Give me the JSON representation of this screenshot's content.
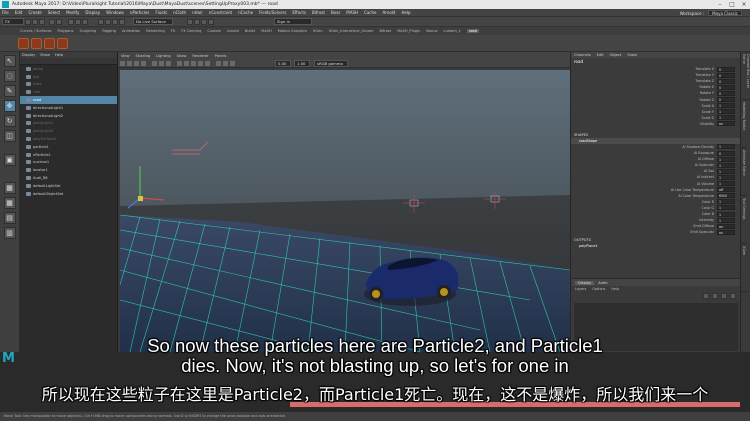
{
  "window": {
    "title": "Autodesk Maya 2017: D:\\Video\\Pluralsight Tutorial\\2016\\Maya\\Dust\\MayaDust\\scenes\\SettingUpProxy003.mb* --- road"
  },
  "menubar": {
    "items": [
      "File",
      "Edit",
      "Create",
      "Select",
      "Modify",
      "Display",
      "Windows",
      "nParticles",
      "Fluids",
      "nCloth",
      "nHair",
      "nConstraint",
      "nCache",
      "Fields/Solvers",
      "Effects",
      "Bifrost",
      "Boss",
      "MASH",
      "Cache",
      "Arnold",
      "Help"
    ],
    "workspace_label": "Workspace :",
    "workspace_value": "Maya Classic"
  },
  "statusline": {
    "mode": "FX",
    "live_surface": "No Live Surface",
    "sign_in": "Sign In"
  },
  "shelf": {
    "tabs": [
      "Curves / Surfaces",
      "Polygons",
      "Sculpting",
      "Rigging",
      "Animation",
      "Rendering",
      "FX",
      "FX Caching",
      "Custom",
      "Arnold",
      "Bullet",
      "MASH",
      "Motion Graphics",
      "XGen",
      "XGen_Interactive_Groom",
      "Bifrost",
      "MASH_Plugin",
      "Bonus",
      "custom_1",
      "road"
    ],
    "active_tab": "road"
  },
  "outliner": {
    "menu": [
      "Display",
      "Show",
      "Help"
    ],
    "items": [
      {
        "label": "persp",
        "dim": true
      },
      {
        "label": "top",
        "dim": true
      },
      {
        "label": "front",
        "dim": true
      },
      {
        "label": "side",
        "dim": true
      },
      {
        "label": "road",
        "dim": false,
        "selected": true
      },
      {
        "label": "directionalLight1",
        "dim": false
      },
      {
        "label": "directionalLight2",
        "dim": false
      },
      {
        "label": "pointLight1",
        "dim": true
      },
      {
        "label": "pointLight2",
        "dim": true
      },
      {
        "label": "polySurface1",
        "dim": true
      },
      {
        "label": "particle1",
        "dim": false
      },
      {
        "label": "nParticle1",
        "dim": false
      },
      {
        "label": "nucleus1",
        "dim": false
      },
      {
        "label": "locator1",
        "dim": false
      },
      {
        "label": "Audi_R8",
        "dim": false
      },
      {
        "label": "defaultLightSet",
        "dim": false
      },
      {
        "label": "defaultObjectSet",
        "dim": false
      }
    ]
  },
  "viewport": {
    "menu": [
      "View",
      "Shading",
      "Lighting",
      "Show",
      "Renderer",
      "Panels"
    ],
    "near_value": "0.00",
    "far_value": "1.00",
    "color_space": "sRGB gamma"
  },
  "channelbox": {
    "menu": [
      "Channels",
      "Edit",
      "Object",
      "Show"
    ],
    "object": "road",
    "channels": [
      {
        "label": "Translate X",
        "value": "0"
      },
      {
        "label": "Translate Y",
        "value": "0"
      },
      {
        "label": "Translate Z",
        "value": "0"
      },
      {
        "label": "Rotate X",
        "value": "0"
      },
      {
        "label": "Rotate Y",
        "value": "0"
      },
      {
        "label": "Rotate Z",
        "value": "0"
      },
      {
        "label": "Scale X",
        "value": "1"
      },
      {
        "label": "Scale Y",
        "value": "1"
      },
      {
        "label": "Scale Z",
        "value": "1"
      },
      {
        "label": "Visibility",
        "value": "on"
      }
    ],
    "shapes_label": "SHAPES",
    "shape_name": "roadShape",
    "shape_channels": [
      {
        "label": "Ai Shadow Density",
        "value": "1"
      },
      {
        "label": "Ai Exposure",
        "value": "0"
      },
      {
        "label": "Ai Diffuse",
        "value": "1"
      },
      {
        "label": "Ai Specular",
        "value": "1"
      },
      {
        "label": "Ai Sss",
        "value": "1"
      },
      {
        "label": "Ai Indirect",
        "value": "1"
      },
      {
        "label": "Ai Volume",
        "value": "1"
      },
      {
        "label": "Ai Use Color Temperature",
        "value": "off"
      },
      {
        "label": "Ai Color Temperature",
        "value": "6500"
      },
      {
        "label": "Color R",
        "value": "1"
      },
      {
        "label": "Color G",
        "value": "1"
      },
      {
        "label": "Color B",
        "value": "1"
      },
      {
        "label": "Intensity",
        "value": "1"
      },
      {
        "label": "Emit Diffuse",
        "value": "on"
      },
      {
        "label": "Emit Specular",
        "value": "on"
      }
    ],
    "outputs_label": "OUTPUTS",
    "output_name": "polyPlane1"
  },
  "layer_editor": {
    "tabs": [
      "Display",
      "Anim"
    ],
    "active_tab": "Display",
    "menu": [
      "Layers",
      "Options",
      "Help"
    ]
  },
  "side_tabs": [
    "Channel Box / Layer Editor",
    "Modelling Toolkit",
    "Attribute Editor",
    "Tool Settings",
    "XGen"
  ],
  "subtitles": {
    "english": "So now these particles here are Particle2, and Particle1\ndies. Now, it's not blasting up, so let's for one in",
    "chinese": "所以现在这些粒子在这里是Particle2，而Particle1死亡。现在，这不是爆炸，所以我们来一个"
  },
  "help_line": "Move Tool: Use manipulator to move object(s). Ctrl+LMB-drag to move components along normals. Use D or INSERT to change the pivot position and axis orientation.",
  "colors": {
    "accent_select": "#5285a6",
    "grid_green": "#2fe0b0",
    "maya_logo": "#21a6c3",
    "timeline_red": "#d86b6b"
  }
}
